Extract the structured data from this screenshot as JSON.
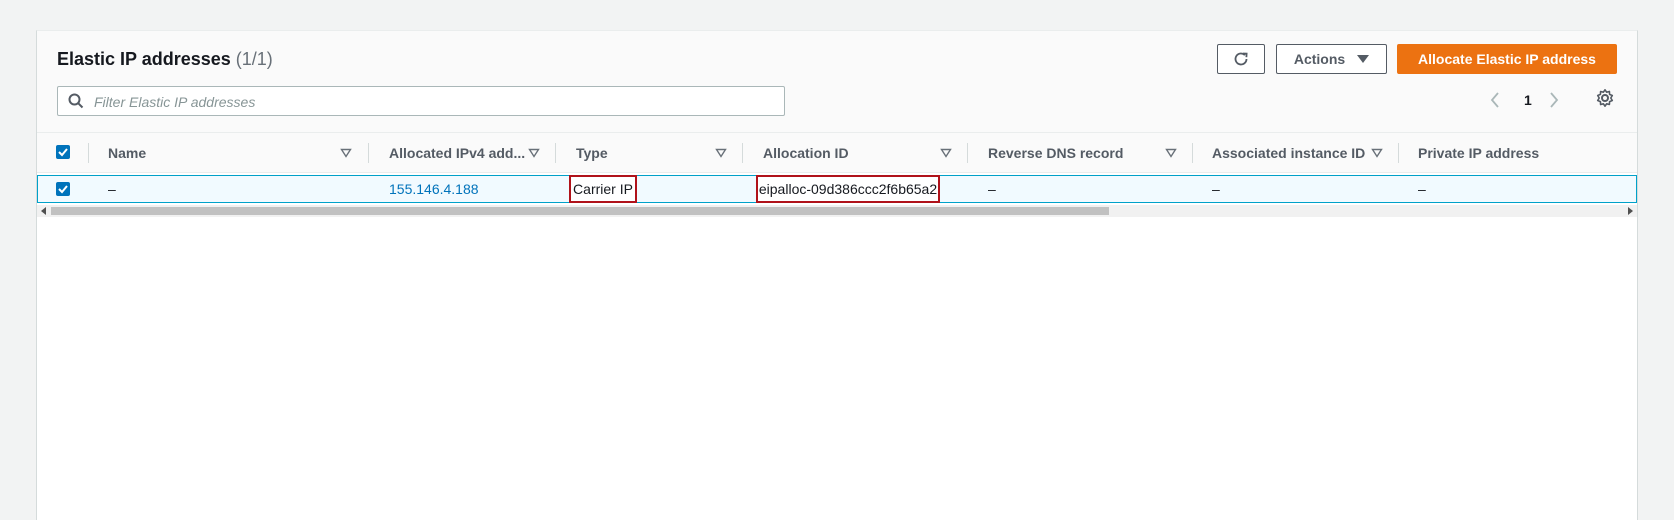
{
  "header": {
    "title": "Elastic IP addresses",
    "count": "(1/1)",
    "actions_label": "Actions",
    "allocate_label": "Allocate Elastic IP address"
  },
  "search": {
    "placeholder": "Filter Elastic IP addresses",
    "value": ""
  },
  "pagination": {
    "current_page": "1"
  },
  "table": {
    "columns": [
      "Name",
      "Allocated IPv4 add...",
      "Type",
      "Allocation ID",
      "Reverse DNS record",
      "Associated instance ID",
      "Private IP address"
    ],
    "rows": [
      {
        "selected": true,
        "name": "–",
        "allocated_ipv4": "155.146.4.188",
        "type": "Carrier IP",
        "allocation_id": "eipalloc-09d386ccc2f6b65a2",
        "reverse_dns": "–",
        "associated_instance_id": "–",
        "private_ip": "–"
      }
    ]
  },
  "colors": {
    "primary_button": "#ec7211",
    "link": "#0073bb",
    "selected_row_bg": "#f1faff",
    "selected_row_border": "#00a1c9",
    "highlight_box": "#b0121a"
  },
  "icons": {
    "refresh": "refresh-icon",
    "caret": "caret-down-icon",
    "search": "search-icon",
    "prev": "chevron-left-icon",
    "next": "chevron-right-icon",
    "settings": "gear-icon",
    "sort": "sort-triangle-icon"
  }
}
